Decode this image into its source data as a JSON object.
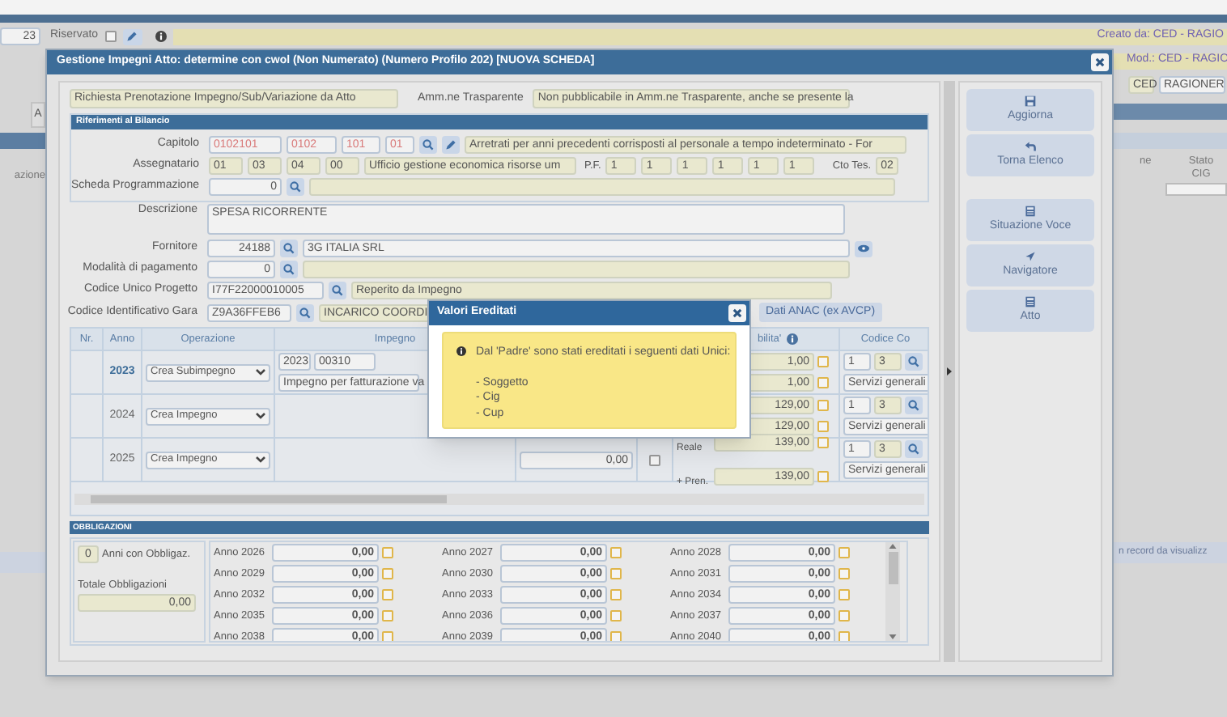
{
  "background": {
    "record_number": "23",
    "reserved": {
      "label": "Riservato",
      "checked": false
    },
    "created_by": "Creato da: CED - RAGIO",
    "modified_by": "Mod.: CED - RAGIO",
    "office_code": "CED",
    "office_name": "RAGIONER",
    "tab_fragment": "A",
    "column_left_fragment": "azione",
    "column_mid_fragment": "ne",
    "column_right": "Stato CIG",
    "status_fragment": "n record da visualizz"
  },
  "dialog": {
    "title": "Gestione Impegni Atto: determine con cwol (Non Numerato) (Numero Profilo 202) [NUOVA SCHEDA]",
    "request_type": "Richiesta Prenotazione Impegno/Sub/Variazione da Atto",
    "transparency_label": "Amm.ne Trasparente",
    "transparency_value": "Non pubblicabile in Amm.ne Trasparente, anche se presente la",
    "budget_section": {
      "title": "Riferimenti al Bilancio",
      "capitolo": {
        "label": "Capitolo",
        "codes": [
          "0102101",
          "0102",
          "101",
          "01"
        ],
        "description": "Arretrati per anni precedenti corrisposti al personale a tempo indeterminato - For"
      },
      "assegnatario": {
        "label": "Assegnatario",
        "codes": [
          "01",
          "03",
          "04",
          "00"
        ],
        "description": "Ufficio gestione economica risorse um",
        "pf_label": "P.F.",
        "pf_codes": [
          "1",
          "1",
          "1",
          "1",
          "1",
          "1"
        ],
        "treasury_label": "Cto Tes.",
        "treasury_code": "02"
      },
      "scheda": {
        "label": "Scheda Programmazione",
        "code": "0"
      }
    },
    "descrizione": {
      "label": "Descrizione",
      "value": "SPESA RICORRENTE"
    },
    "lookups": [
      {
        "label": "Fornitore",
        "code": "24188",
        "description": "3G ITALIA SRL",
        "readonly": false,
        "view_button": true
      },
      {
        "label": "Modalità di pagamento",
        "code": "0",
        "readonly": true,
        "view_button": false
      },
      {
        "label": "Codice Unico Progetto",
        "code": "I77F22000010005",
        "description": "Reperito da Impegno",
        "readonly": true,
        "view_button": false
      },
      {
        "label": "Codice Identificativo Gara",
        "code": "Z9A36FFEB6",
        "description": "INCARICO COORDI",
        "readonly": true,
        "view_button": false
      }
    ],
    "anac_button": "Dati ANAC (ex AVCP)",
    "grid": {
      "columns": [
        "Nr.",
        "Anno",
        "Operazione",
        "Impegno",
        "bilita'",
        "Codice Co"
      ],
      "rows": [
        {
          "year": "2023",
          "selected": true,
          "operation": "Crea Subimpegno",
          "commitment_year": "2023",
          "commitment_number": "00310",
          "commitment_description": "Impegno per fatturazione va",
          "amount_real": "1,00",
          "real_checked": false,
          "amount_reserved": "1,00",
          "reserved_checked": false,
          "code_1": "1",
          "code_2": "3",
          "service": "Servizi generali"
        },
        {
          "year": "2024",
          "selected": false,
          "operation": "Crea Impegno",
          "amount_real": "129,00",
          "real_checked": false,
          "amount_reserved": "129,00",
          "reserved_checked": false,
          "code_1": "1",
          "code_2": "3",
          "service": "Servizi generali"
        },
        {
          "year": "2025",
          "selected": false,
          "operation": "Crea Impegno",
          "amount": "0,00",
          "checked": false,
          "real_label": "Reale",
          "amount_real": "139,00",
          "real_checked": false,
          "reserved_label": "+ Pren.",
          "amount_reserved": "139,00",
          "reserved_checked": false,
          "code_1": "1",
          "code_2": "3",
          "service": "Servizi generali"
        }
      ]
    },
    "obligations": {
      "title": "OBBLIGAZIONI",
      "years_count": "0",
      "years_label": "Anni con Obbligaz.",
      "total_label": "Totale Obbligazioni",
      "total": "0,00",
      "years": [
        {
          "label": "Anno 2026",
          "amount": "0,00",
          "checked": false
        },
        {
          "label": "Anno 2027",
          "amount": "0,00",
          "checked": false
        },
        {
          "label": "Anno 2028",
          "amount": "0,00",
          "checked": false
        },
        {
          "label": "Anno 2029",
          "amount": "0,00",
          "checked": false
        },
        {
          "label": "Anno 2030",
          "amount": "0,00",
          "checked": false
        },
        {
          "label": "Anno 2031",
          "amount": "0,00",
          "checked": false
        },
        {
          "label": "Anno 2032",
          "amount": "0,00",
          "checked": false
        },
        {
          "label": "Anno 2033",
          "amount": "0,00",
          "checked": false
        },
        {
          "label": "Anno 2034",
          "amount": "0,00",
          "checked": false
        },
        {
          "label": "Anno 2035",
          "amount": "0,00",
          "checked": false
        },
        {
          "label": "Anno 2036",
          "amount": "0,00",
          "checked": false
        },
        {
          "label": "Anno 2037",
          "amount": "0,00",
          "checked": false
        },
        {
          "label": "Anno 2038",
          "amount": "0,00",
          "checked": false
        },
        {
          "label": "Anno 2039",
          "amount": "0,00",
          "checked": false
        },
        {
          "label": "Anno 2040",
          "amount": "0,00",
          "checked": false
        }
      ]
    },
    "button_groups": [
      [
        "Aggiorna",
        "Torna Elenco"
      ],
      [
        "Situazione Voce",
        "Navigatore",
        "Atto"
      ]
    ]
  },
  "popup": {
    "title": "Valori Ereditati",
    "message": "Dal 'Padre' sono stati ereditati i seguenti dati Unici:",
    "items": [
      "- Soggetto",
      "- Cig",
      "- Cup"
    ]
  }
}
